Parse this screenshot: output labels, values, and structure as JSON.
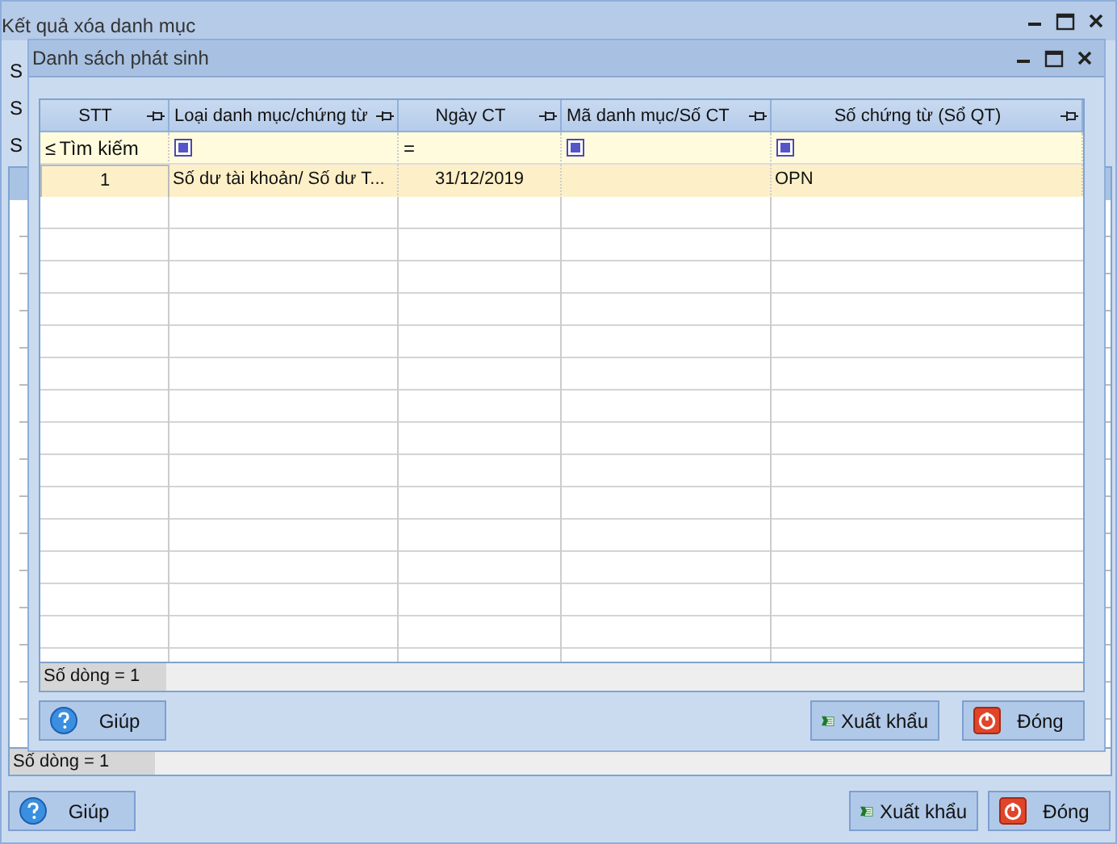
{
  "window": {
    "title": "Kết quả xóa danh mục",
    "labels": [
      "S",
      "S",
      "S"
    ],
    "status": "Số dòng = 1",
    "buttons": [
      {
        "kind": "help",
        "label": "Giúp"
      },
      {
        "kind": "export",
        "label": "Xuất khẩu"
      },
      {
        "kind": "close",
        "label": "Đóng"
      }
    ]
  },
  "dialog": {
    "title": "Danh sách phát sinh",
    "table": {
      "columns": [
        "STT",
        "Loại  danh mục/chứng từ",
        "Ngày CT",
        "Mã danh mục/Số CT",
        "Số chứng từ (Sổ QT)"
      ],
      "filter_row": [
        {
          "kind": "search",
          "operator": "≤",
          "placeholder": "Tìm kiếm"
        },
        {
          "kind": "box"
        },
        {
          "kind": "operator",
          "operator": "="
        },
        {
          "kind": "box"
        },
        {
          "kind": "box"
        }
      ],
      "rows": [
        {
          "selected": true,
          "cells": [
            "1",
            "Số dư tài khoản/ Số dư T...",
            "31/12/2019",
            "",
            "OPN"
          ]
        }
      ]
    },
    "status": "Số dòng = 1",
    "buttons": [
      {
        "kind": "help",
        "label": "Giúp"
      },
      {
        "kind": "export",
        "label": "Xuất khẩu"
      },
      {
        "kind": "close",
        "label": "Đóng"
      }
    ]
  }
}
